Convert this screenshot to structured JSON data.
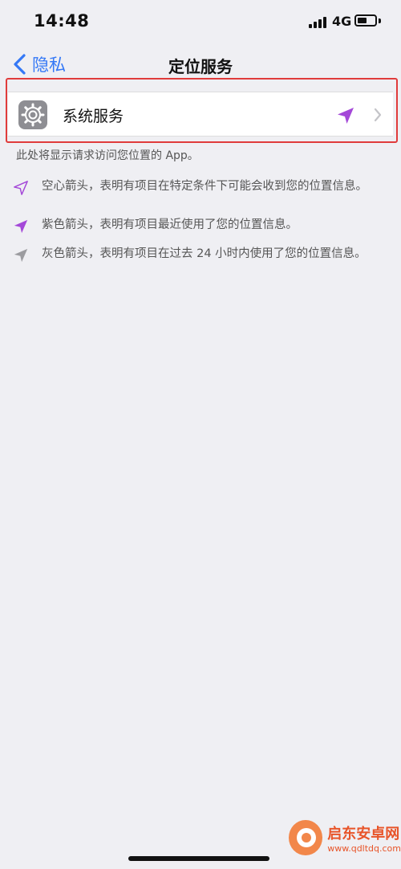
{
  "status_bar": {
    "time": "14:48",
    "network": "4G"
  },
  "nav": {
    "back_label": "隐私",
    "title": "定位服务"
  },
  "list": {
    "items": [
      {
        "label": "系统服务",
        "icon": "gear-icon",
        "indicator": "location-arrow-purple-icon"
      }
    ]
  },
  "footnote": "此处将显示请求访问您位置的 App。",
  "legend": [
    {
      "icon": "hollow-arrow-icon",
      "text": "空心箭头，表明有项目在特定条件下可能会收到您的位置信息。"
    },
    {
      "icon": "purple-arrow-icon",
      "text": "紫色箭头，表明有项目最近使用了您的位置信息。"
    },
    {
      "icon": "gray-arrow-icon",
      "text": "灰色箭头，表明有项目在过去 24 小时内使用了您的位置信息。"
    }
  ],
  "watermark": {
    "name": "启东安卓网",
    "url": "www.qdltdq.com"
  },
  "colors": {
    "accent": "#3478f6",
    "purple": "#a448d8",
    "gray": "#9c9ca0",
    "highlight": "#e03b3b"
  }
}
